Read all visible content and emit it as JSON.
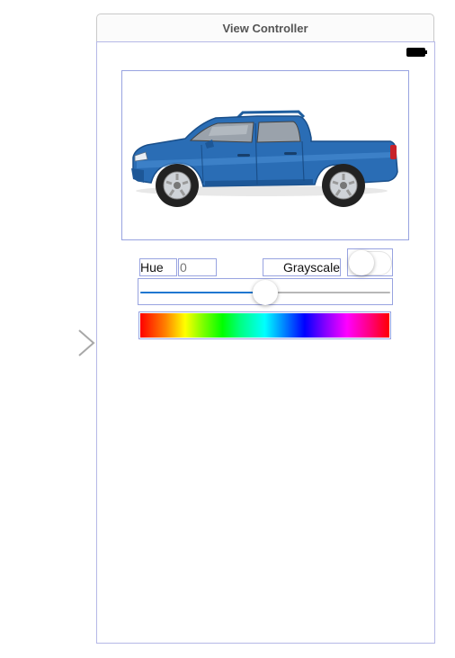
{
  "scene": {
    "title": "View Controller"
  },
  "image_view": {
    "subject": "blue pickup truck",
    "icon": "truck-image"
  },
  "controls": {
    "hue_label": "Hue",
    "hue_value": "0",
    "grayscale_label": "Grayscale",
    "grayscale_on": false,
    "slider_value_fraction": 0.5
  },
  "colors": {
    "selection_outline": "#98a3e0",
    "slider_fill": "#1f77d0",
    "truck_body": "#2a6db5"
  }
}
